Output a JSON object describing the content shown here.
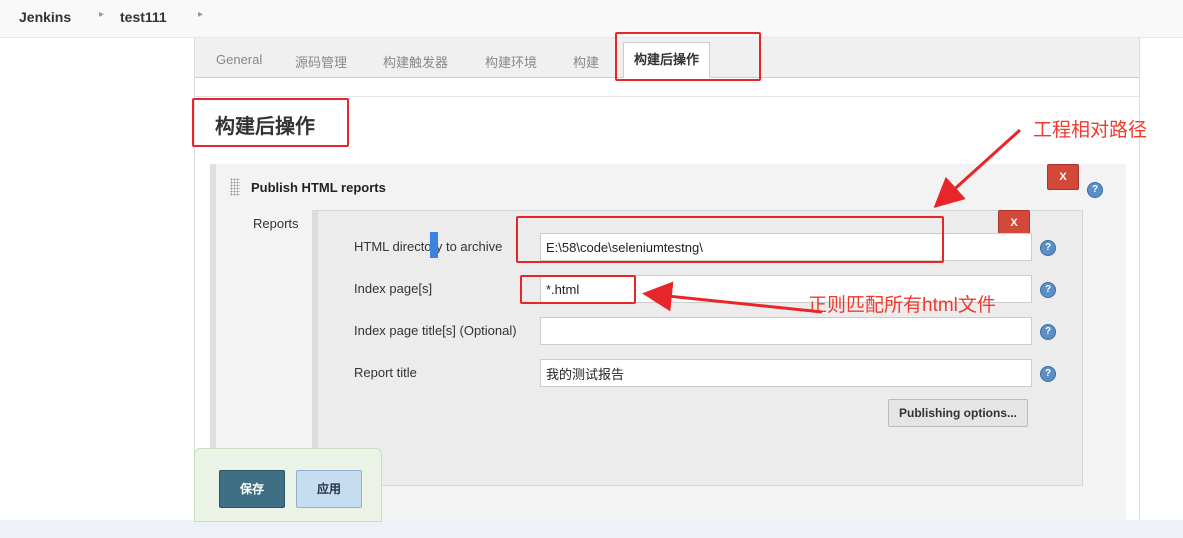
{
  "breadcrumb": {
    "items": [
      "Jenkins",
      "test111"
    ]
  },
  "tabs": [
    "General",
    "源码管理",
    "构建触发器",
    "构建环境",
    "构建",
    "构建后操作"
  ],
  "section_title": "构建后操作",
  "publish": {
    "title": "Publish HTML reports",
    "reports_label": "Reports",
    "fields": [
      {
        "label": "HTML directory to archive",
        "value": "E:\\58\\code\\seleniumtestng\\"
      },
      {
        "label": "Index page[s]",
        "value": "*.html"
      },
      {
        "label": "Index page title[s] (Optional)",
        "value": ""
      },
      {
        "label": "Report title",
        "value": "我的测试报告"
      }
    ],
    "publishing_options": "Publishing options...",
    "delete_label": "X",
    "help_label": "?"
  },
  "footer": {
    "save": "保存",
    "apply": "应用"
  },
  "annotations": {
    "relative_path": "工程相对路径",
    "regex_note": "正则匹配所有html文件"
  },
  "colors": {
    "annotation_red": "#e8262a",
    "save_button": "#3e6f84",
    "apply_button": "#c6dcef",
    "delete_button": "#d24939"
  }
}
